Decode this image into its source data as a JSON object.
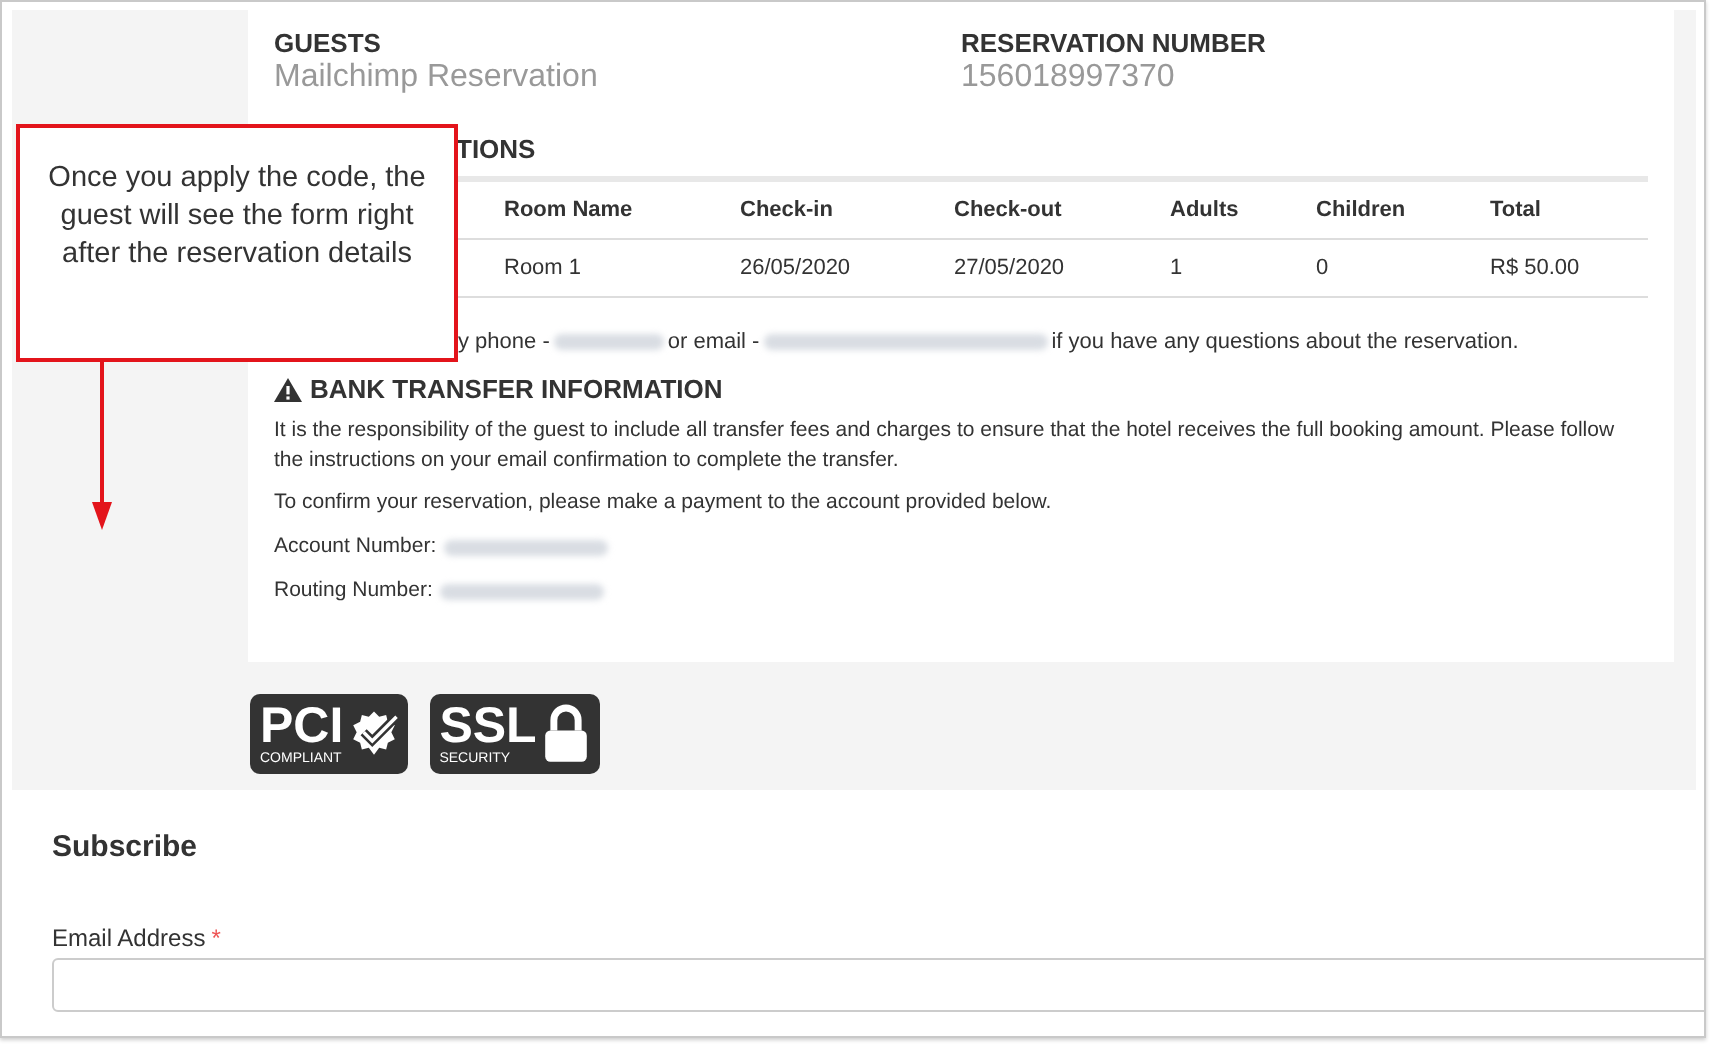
{
  "guests": {
    "label": "GUESTS",
    "value": "Mailchimp Reservation"
  },
  "reservation_number": {
    "label": "RESERVATION NUMBER",
    "value": "156018997370"
  },
  "accommodations": {
    "heading": "TIONS",
    "columns": [
      "Room Name",
      "Check-in",
      "Check-out",
      "Adults",
      "Children",
      "Total"
    ],
    "rows": [
      [
        "Room 1",
        "26/05/2020",
        "27/05/2020",
        "1",
        "0",
        "R$ 50.00"
      ]
    ]
  },
  "contact": {
    "phone_label": "y phone -",
    "email_label": "or email -",
    "suffix": "if you have any questions about the reservation."
  },
  "bank_transfer": {
    "heading": "BANK TRANSFER INFORMATION",
    "paragraphs": [
      "It is the responsibility of the guest to include all transfer fees and charges to ensure that the hotel receives the full booking amount. Please follow the instructions on your email confirmation to complete the transfer.",
      "To confirm your reservation, please make a payment to the account provided below."
    ],
    "fields": [
      {
        "label": "Account Number:"
      },
      {
        "label": "Routing Number:"
      }
    ]
  },
  "badges": [
    {
      "kind": "pci",
      "title": "PCI",
      "subtitle": "COMPLIANT"
    },
    {
      "kind": "ssl",
      "title": "SSL",
      "subtitle": "SECURITY"
    }
  ],
  "subscribe": {
    "title": "Subscribe",
    "field": {
      "label": "Email Address",
      "required_mark": "*"
    }
  },
  "callout": {
    "text": "Once you apply the code, the guest will see the form right after the reservation details"
  }
}
